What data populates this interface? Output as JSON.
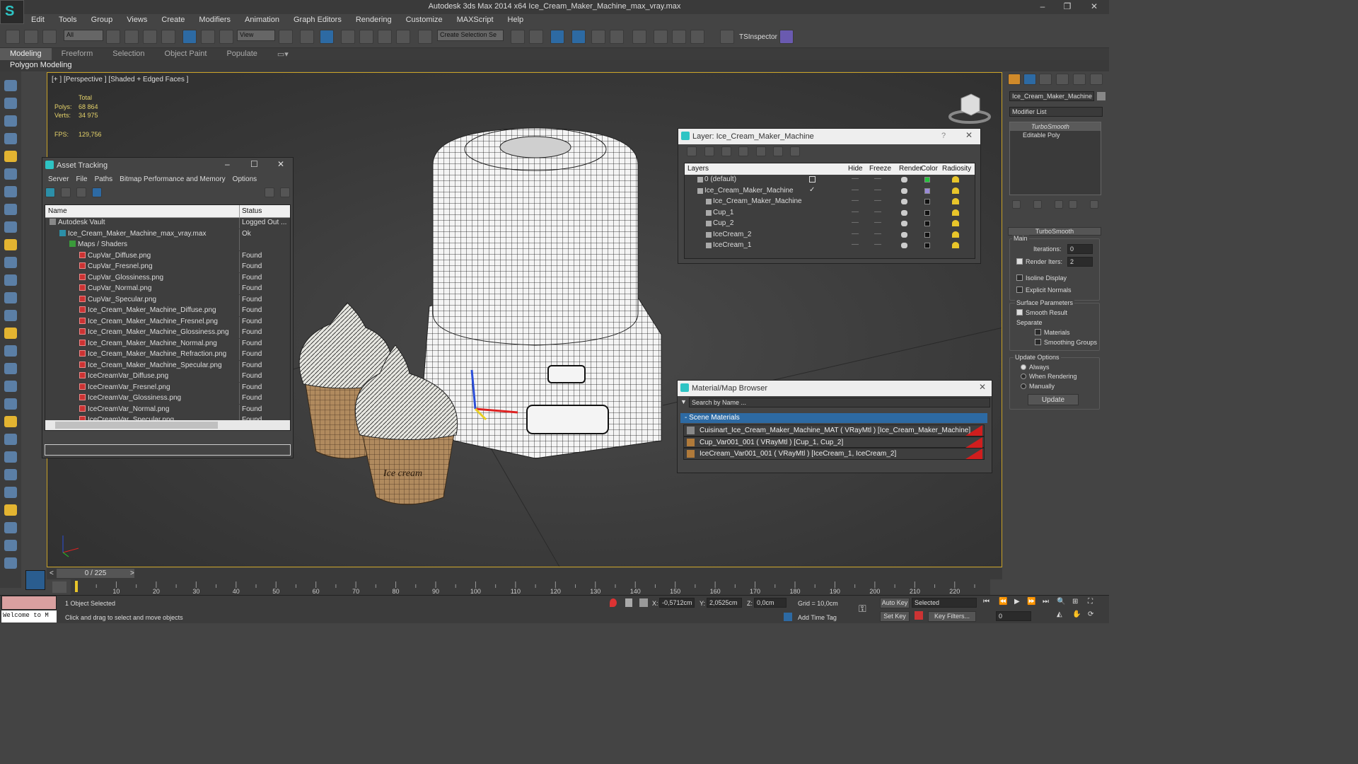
{
  "window": {
    "title": "Autodesk 3ds Max  2014 x64      Ice_Cream_Maker_Machine_max_vray.max",
    "minimize": "–",
    "restore": "❐",
    "close": "✕"
  },
  "menu": [
    "Edit",
    "Tools",
    "Group",
    "Views",
    "Create",
    "Modifiers",
    "Animation",
    "Graph Editors",
    "Rendering",
    "Customize",
    "MAXScript",
    "Help"
  ],
  "toolbar": {
    "filter": "All",
    "refcoord": "View",
    "selset": "Create Selection Se",
    "tsinspector": "TSInspector"
  },
  "ribbon": {
    "tabs": [
      "Modeling",
      "Freeform",
      "Selection",
      "Object Paint",
      "Populate"
    ],
    "subtab": "Polygon Modeling"
  },
  "viewport": {
    "label": "[+ ] [Perspective ] [Shaded + Edged Faces ]",
    "stats": {
      "total": "Total",
      "polys_label": "Polys:",
      "polys": "68 864",
      "verts_label": "Verts:",
      "verts": "34 975",
      "fps_label": "FPS:",
      "fps": "129,756"
    },
    "cone_text": "Ice cream"
  },
  "asset_tracking": {
    "title": "Asset Tracking",
    "menu": [
      "Server",
      "File",
      "Paths",
      "Bitmap Performance and Memory",
      "Options"
    ],
    "columns": [
      "Name",
      "Status"
    ],
    "rows": [
      {
        "name": "Autodesk Vault",
        "status": "Logged Out ...",
        "indent": 0
      },
      {
        "name": "Ice_Cream_Maker_Machine_max_vray.max",
        "status": "Ok",
        "indent": 1
      },
      {
        "name": "Maps / Shaders",
        "status": "",
        "indent": 2
      },
      {
        "name": "CupVar_Diffuse.png",
        "status": "Found",
        "indent": 3
      },
      {
        "name": "CupVar_Fresnel.png",
        "status": "Found",
        "indent": 3
      },
      {
        "name": "CupVar_Glossiness.png",
        "status": "Found",
        "indent": 3
      },
      {
        "name": "CupVar_Normal.png",
        "status": "Found",
        "indent": 3
      },
      {
        "name": "CupVar_Specular.png",
        "status": "Found",
        "indent": 3
      },
      {
        "name": "Ice_Cream_Maker_Machine_Diffuse.png",
        "status": "Found",
        "indent": 3
      },
      {
        "name": "Ice_Cream_Maker_Machine_Fresnel.png",
        "status": "Found",
        "indent": 3
      },
      {
        "name": "Ice_Cream_Maker_Machine_Glossiness.png",
        "status": "Found",
        "indent": 3
      },
      {
        "name": "Ice_Cream_Maker_Machine_Normal.png",
        "status": "Found",
        "indent": 3
      },
      {
        "name": "Ice_Cream_Maker_Machine_Refraction.png",
        "status": "Found",
        "indent": 3
      },
      {
        "name": "Ice_Cream_Maker_Machine_Specular.png",
        "status": "Found",
        "indent": 3
      },
      {
        "name": "IceCreamVar_Diffuse.png",
        "status": "Found",
        "indent": 3
      },
      {
        "name": "IceCreamVar_Fresnel.png",
        "status": "Found",
        "indent": 3
      },
      {
        "name": "IceCreamVar_Glossiness.png",
        "status": "Found",
        "indent": 3
      },
      {
        "name": "IceCreamVar_Normal.png",
        "status": "Found",
        "indent": 3
      },
      {
        "name": "IceCreamVar_Specular.png",
        "status": "Found",
        "indent": 3
      }
    ]
  },
  "layer_dialog": {
    "title": "Layer: Ice_Cream_Maker_Machine",
    "help": "?",
    "columns": [
      "Layers",
      "Hide",
      "Freeze",
      "Render",
      "Color",
      "Radiosity"
    ],
    "rows": [
      {
        "name": "0 (default)",
        "indent": 0,
        "color": "#22c33a"
      },
      {
        "name": "Ice_Cream_Maker_Machine",
        "indent": 0,
        "color": "#9a8ad8"
      },
      {
        "name": "Ice_Cream_Maker_Machine",
        "indent": 1,
        "color": "#111111"
      },
      {
        "name": "Cup_1",
        "indent": 1,
        "color": "#111111"
      },
      {
        "name": "Cup_2",
        "indent": 1,
        "color": "#111111"
      },
      {
        "name": "IceCream_2",
        "indent": 1,
        "color": "#111111"
      },
      {
        "name": "IceCream_1",
        "indent": 1,
        "color": "#111111"
      }
    ]
  },
  "material_browser": {
    "title": "Material/Map Browser",
    "search_placeholder": "Search by Name ...",
    "section": "- Scene Materials",
    "items": [
      "Cuisinart_Ice_Cream_Maker_Machine_MAT ( VRayMtl ) [Ice_Cream_Maker_Machine]",
      "Cup_Var001_001 ( VRayMtl ) [Cup_1, Cup_2]",
      "IceCream_Var001_001 ( VRayMtl ) [IceCream_1, IceCream_2]"
    ]
  },
  "command_panel": {
    "object_name": "Ice_Cream_Maker_Machine",
    "modifier_list": "Modifier List",
    "stack": [
      "TurboSmooth",
      "Editable Poly"
    ],
    "rollout": "TurboSmooth",
    "main": "Main",
    "iterations_label": "Iterations:",
    "iterations": "0",
    "render_iters_label": "Render Iters:",
    "render_iters": "2",
    "isoline": "Isoline Display",
    "explicit_normals": "Explicit Normals",
    "surface_params": "Surface Parameters",
    "smooth_result": "Smooth Result",
    "separate": "Separate",
    "materials": "Materials",
    "smoothing_groups": "Smoothing Groups",
    "update_options": "Update Options",
    "always": "Always",
    "when_rendering": "When Rendering",
    "manually": "Manually",
    "update": "Update"
  },
  "timeline": {
    "frame": "0 / 225",
    "ticks": [
      "10",
      "20",
      "30",
      "40",
      "50",
      "60",
      "70",
      "80",
      "90",
      "100",
      "110",
      "120",
      "130",
      "140",
      "150",
      "160",
      "170",
      "180",
      "190",
      "200",
      "210",
      "220"
    ],
    "max": 225
  },
  "status": {
    "welcome": "Welcome to M",
    "selected": "1 Object Selected",
    "prompt": "Click and drag to select and move objects",
    "x_label": "X:",
    "x": "-0,5712cm",
    "y_label": "Y:",
    "y": "2,0525cm",
    "z_label": "Z:",
    "z": "0,0cm",
    "grid": "Grid = 10,0cm",
    "add_time_tag": "Add Time Tag",
    "auto_key": "Auto Key",
    "set_key": "Set Key",
    "key_mode": "Selected",
    "key_filters": "Key Filters...",
    "frame_field": "0"
  }
}
